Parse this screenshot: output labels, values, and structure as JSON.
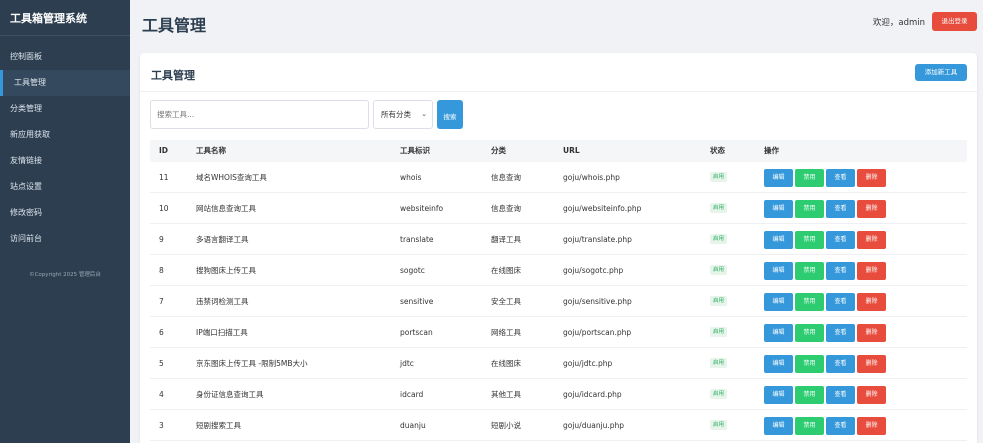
{
  "app": {
    "brand": "工具箱管理系统"
  },
  "sidebar": {
    "items": [
      {
        "label": "控制面板"
      },
      {
        "label": "工具管理"
      },
      {
        "label": "分类管理"
      },
      {
        "label": "新应用获取"
      },
      {
        "label": "友情链接"
      },
      {
        "label": "站点设置"
      },
      {
        "label": "修改密码"
      },
      {
        "label": "访问前台"
      }
    ],
    "copyright": "©Copyright 2025 管理后台"
  },
  "header": {
    "title": "工具管理",
    "welcome": "欢迎，admin",
    "logout_label": "退出登录"
  },
  "card": {
    "title": "工具管理",
    "add_label": "添加新工具"
  },
  "filters": {
    "search_placeholder": "搜索工具...",
    "category_value": "所有分类",
    "search_button": "搜索"
  },
  "table": {
    "headers": [
      "ID",
      "工具名称",
      "工具标识",
      "分类",
      "URL",
      "状态",
      "操作"
    ],
    "rows": [
      {
        "id": "11",
        "name": "域名WHOIS查询工具",
        "key": "whois",
        "category": "信息查询",
        "url": "goju/whois.php",
        "status": "启用"
      },
      {
        "id": "10",
        "name": "网站信息查询工具",
        "key": "websiteinfo",
        "category": "信息查询",
        "url": "goju/websiteinfo.php",
        "status": "启用"
      },
      {
        "id": "9",
        "name": "多语言翻译工具",
        "key": "translate",
        "category": "翻译工具",
        "url": "goju/translate.php",
        "status": "启用"
      },
      {
        "id": "8",
        "name": "搜狗图床上传工具",
        "key": "sogotc",
        "category": "在线图床",
        "url": "goju/sogotc.php",
        "status": "启用"
      },
      {
        "id": "7",
        "name": "违禁词检测工具",
        "key": "sensitive",
        "category": "安全工具",
        "url": "goju/sensitive.php",
        "status": "启用"
      },
      {
        "id": "6",
        "name": "IP端口扫描工具",
        "key": "portscan",
        "category": "网络工具",
        "url": "goju/portscan.php",
        "status": "启用"
      },
      {
        "id": "5",
        "name": "京东图床上传工具 -限制5MB大小",
        "key": "jdtc",
        "category": "在线图床",
        "url": "goju/jdtc.php",
        "status": "启用"
      },
      {
        "id": "4",
        "name": "身份证信息查询工具",
        "key": "idcard",
        "category": "其他工具",
        "url": "goju/idcard.php",
        "status": "启用"
      },
      {
        "id": "3",
        "name": "短剧搜索工具",
        "key": "duanju",
        "category": "短剧小说",
        "url": "goju/duanju.php",
        "status": "启用"
      }
    ],
    "actions": {
      "edit": "编辑",
      "disable": "禁用",
      "view": "查看",
      "delete": "删除"
    }
  },
  "colors": {
    "sidebar_bg": "#2c3e50",
    "primary": "#3498db",
    "success": "#2ecc71",
    "danger": "#e74c3c"
  }
}
